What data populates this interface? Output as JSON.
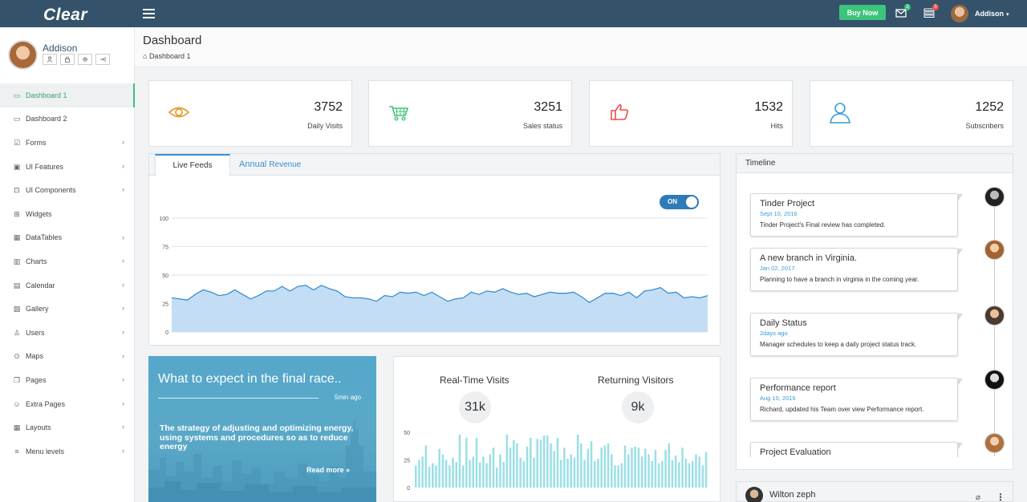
{
  "app": {
    "logo": "Clear"
  },
  "topbar": {
    "buy_label": "Buy Now",
    "mail_badge": "2",
    "list_badge": "5",
    "user_name": "Addison",
    "colors": {
      "bar": "#34536b",
      "buy": "#3cc47c"
    }
  },
  "sidebar": {
    "profile_name": "Addison",
    "tools": [
      "user-icon",
      "lock-icon",
      "gear-icon",
      "logout-icon"
    ],
    "items": [
      {
        "label": "Dashboard 1",
        "icon": "monitor-icon",
        "active": true,
        "chevron": false
      },
      {
        "label": "Dashboard 2",
        "icon": "screen-icon",
        "active": false,
        "chevron": false
      },
      {
        "label": "Forms",
        "icon": "checkbox-icon",
        "active": false,
        "chevron": true
      },
      {
        "label": "UI Features",
        "icon": "desktop-icon",
        "active": false,
        "chevron": true
      },
      {
        "label": "UI Components",
        "icon": "briefcase-icon",
        "active": false,
        "chevron": true
      },
      {
        "label": "Widgets",
        "icon": "grid-icon",
        "active": false,
        "chevron": false
      },
      {
        "label": "DataTables",
        "icon": "table-icon",
        "active": false,
        "chevron": true
      },
      {
        "label": "Charts",
        "icon": "bar-chart-icon",
        "active": false,
        "chevron": true
      },
      {
        "label": "Calendar",
        "icon": "calendar-icon",
        "active": false,
        "chevron": true
      },
      {
        "label": "Gallery",
        "icon": "image-icon",
        "active": false,
        "chevron": true
      },
      {
        "label": "Users",
        "icon": "user-icon",
        "active": false,
        "chevron": true
      },
      {
        "label": "Maps",
        "icon": "map-pin-icon",
        "active": false,
        "chevron": true
      },
      {
        "label": "Pages",
        "icon": "pages-icon",
        "active": false,
        "chevron": true
      },
      {
        "label": "Extra Pages",
        "icon": "smiley-icon",
        "active": false,
        "chevron": true
      },
      {
        "label": "Layouts",
        "icon": "layout-icon",
        "active": false,
        "chevron": true
      },
      {
        "label": "Menu levels",
        "icon": "menu-icon",
        "active": false,
        "chevron": true
      }
    ]
  },
  "header": {
    "title": "Dashboard",
    "breadcrumb": "Dashboard 1"
  },
  "stats": [
    {
      "value": "3752",
      "label": "Daily Visits",
      "icon": "eye-icon",
      "color": "#e5a13a"
    },
    {
      "value": "3251",
      "label": "Sales status",
      "icon": "cart-icon",
      "color": "#3cc47c"
    },
    {
      "value": "1532",
      "label": "Hits",
      "icon": "thumbs-up-icon",
      "color": "#e9504b"
    },
    {
      "value": "1252",
      "label": "Subscribers",
      "icon": "user-icon",
      "color": "#3a9ad9"
    }
  ],
  "feed": {
    "tab_active": "Live Feeds",
    "tab_other_main": "Annual",
    "tab_other_sub": "Revenue",
    "toggle_label": "ON",
    "chart_data": {
      "type": "area",
      "ylim": [
        0,
        100
      ],
      "y_ticks": [
        "0",
        "25",
        "50",
        "75",
        "100"
      ],
      "grid": true,
      "values": [
        30,
        29,
        28,
        33,
        37,
        35,
        32,
        33,
        37,
        33,
        29,
        32,
        36,
        36,
        40,
        36,
        40,
        41,
        37,
        41,
        38,
        36,
        31,
        30,
        30,
        29,
        27,
        32,
        31,
        35,
        34,
        35,
        32,
        35,
        31,
        27,
        29,
        30,
        35,
        33,
        36,
        35,
        38,
        35,
        33,
        34,
        31,
        33,
        35,
        34,
        34,
        35,
        31,
        26,
        30,
        34,
        34,
        32,
        35,
        30,
        36,
        37,
        39,
        34,
        35,
        30,
        31,
        30,
        32
      ],
      "color": "#3a8fd0"
    }
  },
  "promo": {
    "title": "What to expect in the final race..",
    "time": "5min ago",
    "body": "The strategy of adjusting and optimizing energy, using systems and procedures so as to reduce energy",
    "more": "Read more"
  },
  "visits": {
    "realtime_label": "Real-Time Visits",
    "realtime_value": "31k",
    "returning_label": "Returning Visitors",
    "returning_value": "9k",
    "chart_data": {
      "type": "bar",
      "ylim": [
        0,
        50
      ],
      "y_ticks": [
        "0",
        "25",
        "50"
      ],
      "values": [
        20,
        25,
        28,
        38,
        19,
        22,
        20,
        35,
        30,
        25,
        20,
        27,
        23,
        48,
        20,
        45,
        25,
        28,
        45,
        23,
        28,
        22,
        30,
        36,
        18,
        30,
        23,
        48,
        36,
        43,
        40,
        27,
        24,
        37,
        45,
        27,
        44,
        43,
        47,
        47,
        40,
        33,
        45,
        25,
        36,
        26,
        30,
        27,
        48,
        40,
        25,
        35,
        42,
        24,
        26,
        36,
        38,
        40,
        30,
        20,
        20,
        22,
        38,
        30,
        36,
        37,
        36,
        28,
        35,
        30,
        24,
        34,
        22,
        24,
        34,
        40,
        25,
        29,
        23,
        36,
        26,
        22,
        24,
        30,
        28,
        20,
        32
      ],
      "color": "#9bdfe6"
    }
  },
  "timeline": {
    "title": "Timeline",
    "items": [
      {
        "title": "Tinder Project",
        "date": "Sept 10, 2016",
        "desc": "Tinder Project's Final review has completed."
      },
      {
        "title": "A new branch in Virginia.",
        "date": "Jan 02, 2017",
        "desc": "Planning to have a branch in virginia in the coming year."
      },
      {
        "title": "Daily Status",
        "date": "2days ago",
        "desc": "Manager schedules to keep a daily project status track."
      },
      {
        "title": "Performance report",
        "date": "Aug 10, 2016",
        "desc": "Richard, updated his Team over view Performance report."
      },
      {
        "title": "Project Evaluation",
        "date": "",
        "desc": ""
      }
    ]
  },
  "comment": {
    "name": "Wilton zeph"
  }
}
